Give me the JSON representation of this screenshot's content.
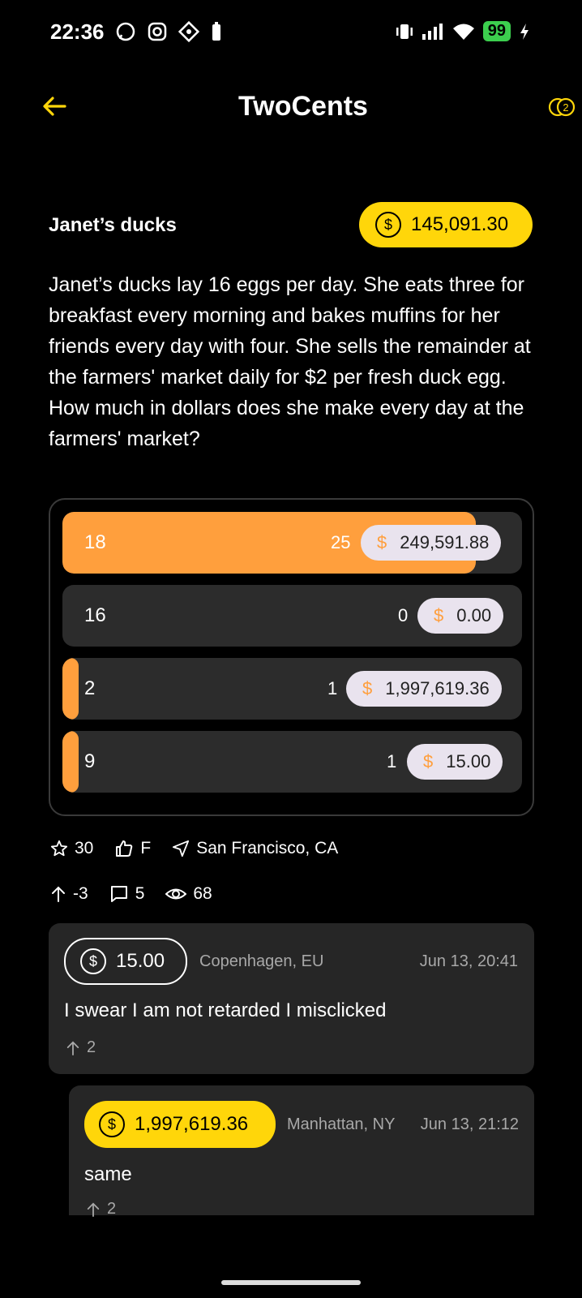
{
  "status_bar": {
    "time": "22:36",
    "battery": "99"
  },
  "header": {
    "title": "TwoCents",
    "coins_icon_text": "2"
  },
  "question": {
    "title": "Janet’s ducks",
    "bounty": "145,091.30",
    "body": "Janet’s ducks lay 16 eggs per day. She eats three for breakfast every morning and bakes muffins for her friends every day with four. She sells the remainder at the farmers' market daily for $2 per fresh duck egg. How much in dollars does she make every day at the farmers' market?"
  },
  "options": [
    {
      "label": "18",
      "count": "25",
      "amount": "249,591.88",
      "fill": 0.9
    },
    {
      "label": "16",
      "count": "0",
      "amount": "0.00",
      "fill": 0.0
    },
    {
      "label": "2",
      "count": "1",
      "amount": "1,997,619.36",
      "fill": 0.035
    },
    {
      "label": "9",
      "count": "1",
      "amount": "15.00",
      "fill": 0.035
    }
  ],
  "currency_symbol": "$",
  "meta": {
    "stars": "30",
    "likes": "F",
    "location": "San Francisco, CA",
    "votes": "-3",
    "comments": "5",
    "views": "68"
  },
  "comments": [
    {
      "amount": "15.00",
      "location": "Copenhagen, EU",
      "time": "Jun 13, 20:41",
      "text": "I swear I am not retarded I misclicked",
      "upvotes": "2"
    },
    {
      "amount": "1,997,619.36",
      "location": "Manhattan, NY",
      "time": "Jun 13, 21:12",
      "text": "same",
      "upvotes": "2"
    }
  ],
  "colors": {
    "accent_yellow": "#ffd60a",
    "accent_orange": "#ff9f3d",
    "card": "#2c2c2c"
  }
}
